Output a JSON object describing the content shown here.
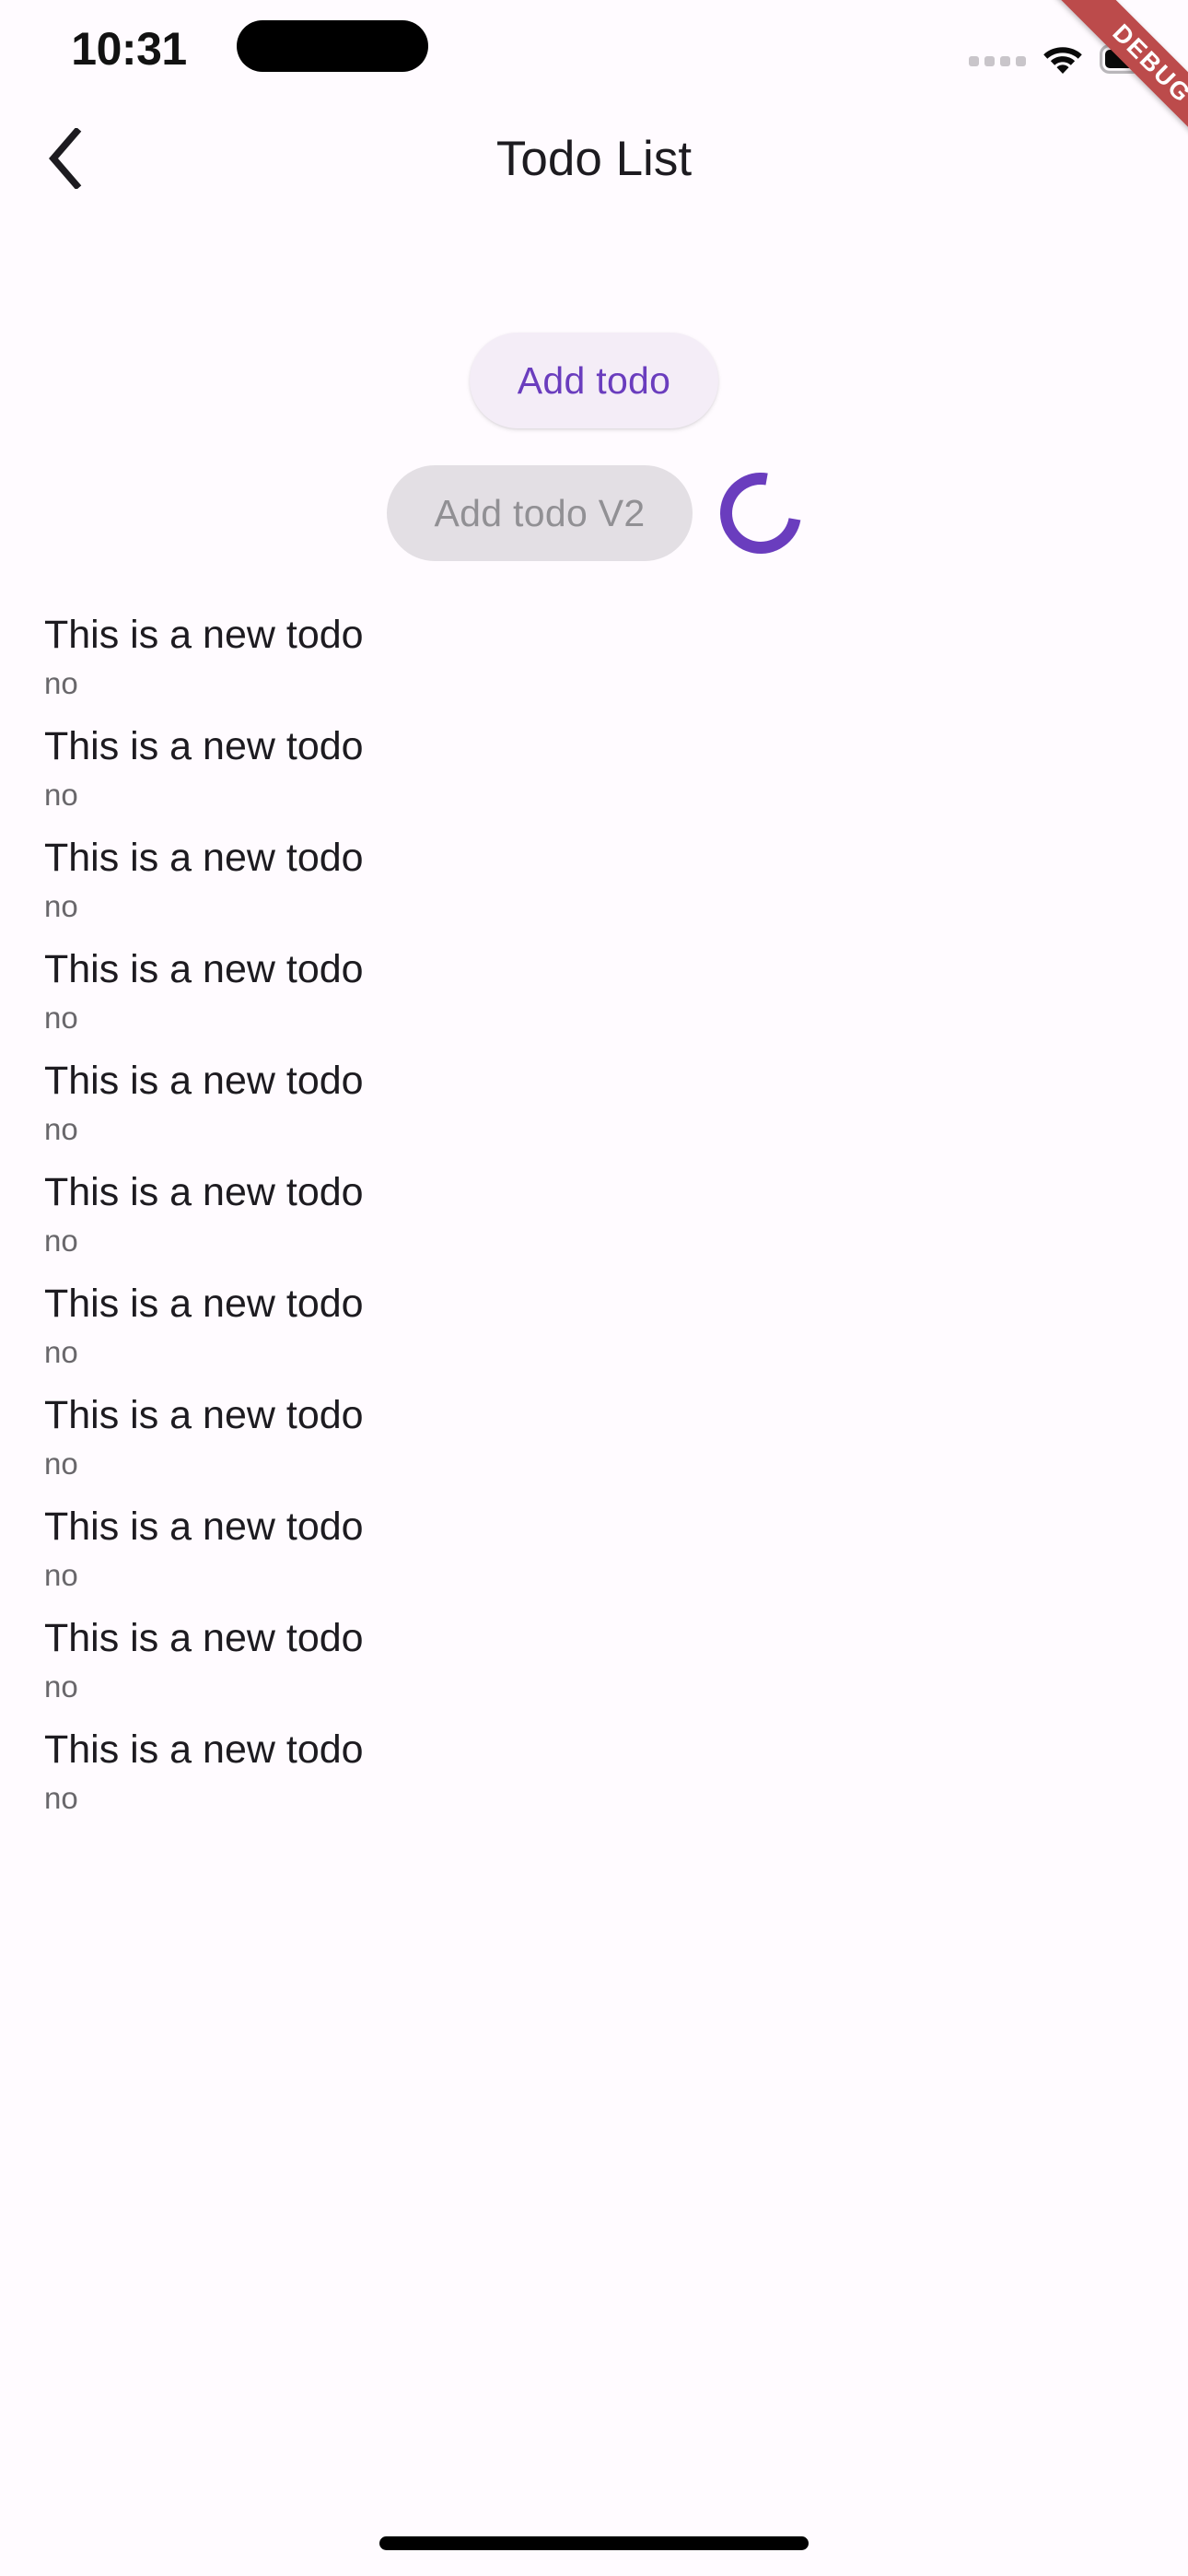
{
  "status_bar": {
    "time": "10:31",
    "cellular_icon": "cellular-dots-icon",
    "wifi_icon": "wifi-icon",
    "battery_icon": "battery-full-icon"
  },
  "debug_banner": {
    "label": "DEBUG",
    "color": "#BC4B4B"
  },
  "app_bar": {
    "back_icon": "chevron-left-icon",
    "title": "Todo List"
  },
  "actions": {
    "add_todo_label": "Add todo",
    "add_todo_v2_label": "Add todo V2",
    "spinner_name": "loading-spinner",
    "accent_color": "#6A3DBE",
    "add_todo_bg": "#F4EDF7",
    "add_todo_v2_bg": "#E3DFE4",
    "add_todo_v2_text_color": "#919094"
  },
  "todos": [
    {
      "title": "This is a new todo",
      "subtitle": "no"
    },
    {
      "title": "This is a new todo",
      "subtitle": "no"
    },
    {
      "title": "This is a new todo",
      "subtitle": "no"
    },
    {
      "title": "This is a new todo",
      "subtitle": "no"
    },
    {
      "title": "This is a new todo",
      "subtitle": "no"
    },
    {
      "title": "This is a new todo",
      "subtitle": "no"
    },
    {
      "title": "This is a new todo",
      "subtitle": "no"
    },
    {
      "title": "This is a new todo",
      "subtitle": "no"
    },
    {
      "title": "This is a new todo",
      "subtitle": "no"
    },
    {
      "title": "This is a new todo",
      "subtitle": "no"
    },
    {
      "title": "This is a new todo",
      "subtitle": "no"
    }
  ],
  "system": {
    "home_indicator": "home-indicator",
    "background_color": "#FFFBFF"
  }
}
